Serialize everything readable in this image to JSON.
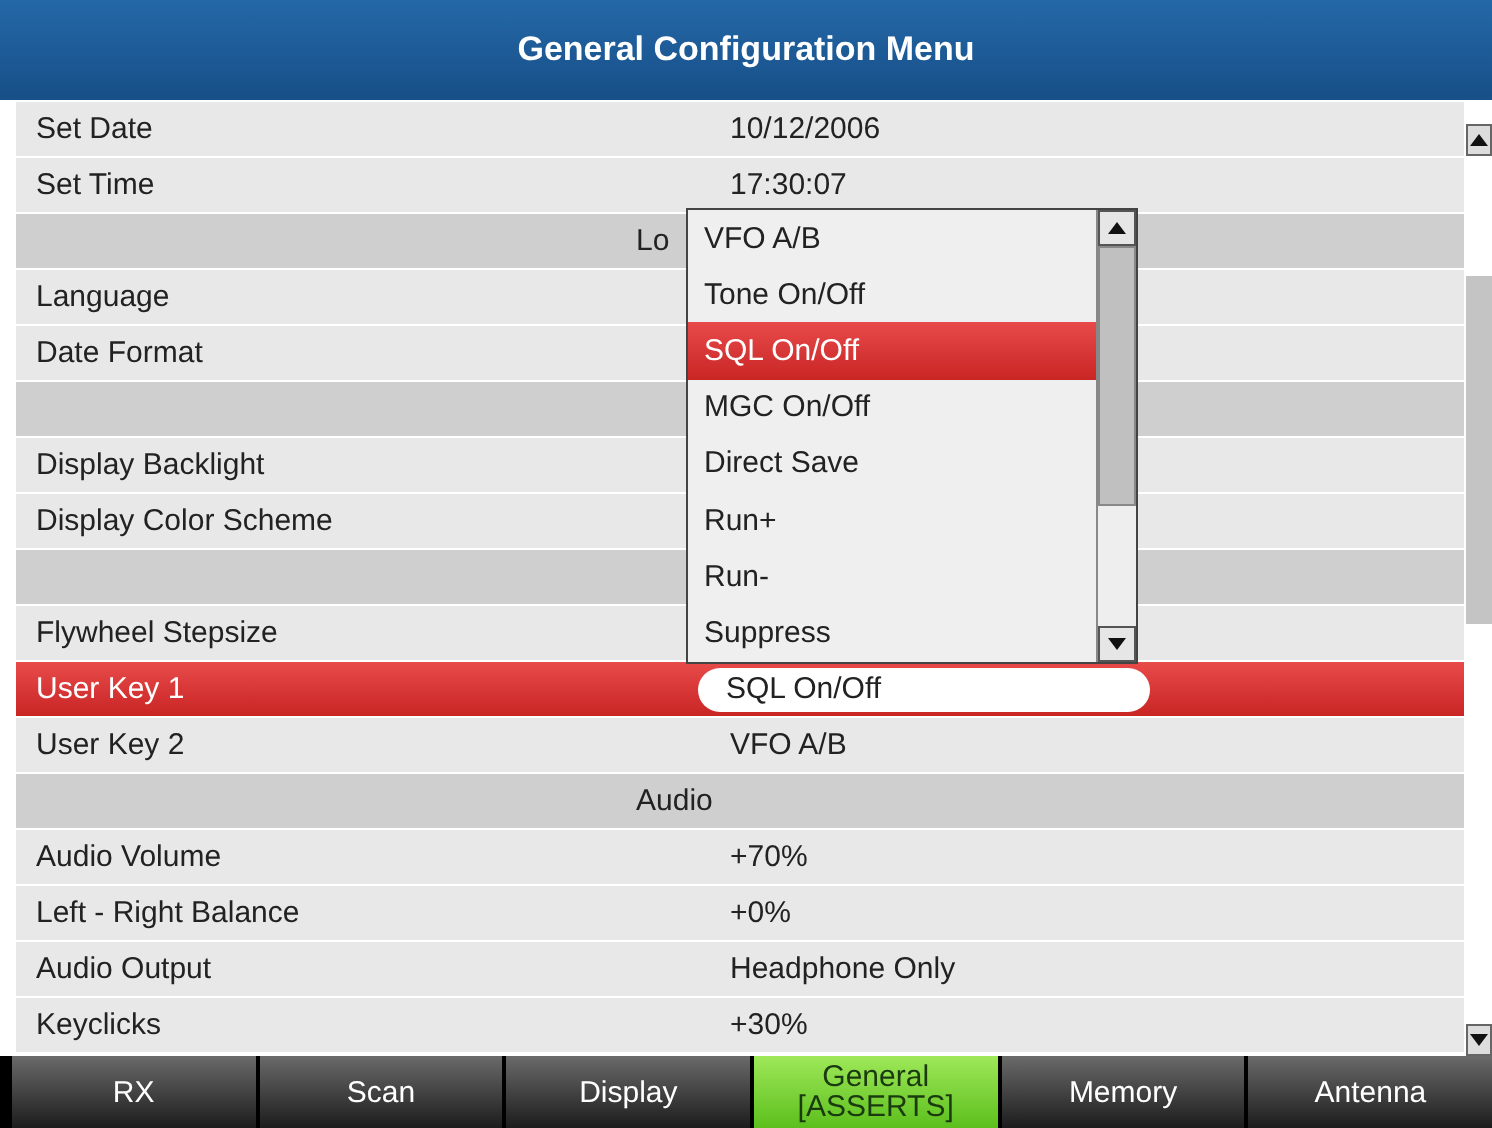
{
  "window": {
    "title": "General Configuration Menu"
  },
  "rows": [
    {
      "kind": "setting",
      "label": "Set Date",
      "value": "10/12/2006",
      "selected": false
    },
    {
      "kind": "setting",
      "label": "Set Time",
      "value": "17:30:07",
      "selected": false
    },
    {
      "kind": "section",
      "title": "Lo"
    },
    {
      "kind": "setting",
      "label": "Language",
      "selected": false
    },
    {
      "kind": "setting",
      "label": "Date Format",
      "selected": false
    },
    {
      "kind": "section"
    },
    {
      "kind": "setting",
      "label": "Display Backlight",
      "selected": false
    },
    {
      "kind": "setting",
      "label": "Display Color Scheme",
      "selected": false
    },
    {
      "kind": "section"
    },
    {
      "kind": "setting",
      "label": "Flywheel Stepsize",
      "selected": false
    },
    {
      "kind": "setting",
      "label": "User Key 1",
      "value": "SQL On/Off",
      "selected": true
    },
    {
      "kind": "setting",
      "label": "User Key 2",
      "value": "VFO A/B",
      "selected": false
    },
    {
      "kind": "section",
      "title": "Audio"
    },
    {
      "kind": "setting",
      "label": "Audio Volume",
      "value": "+70%",
      "selected": false
    },
    {
      "kind": "setting",
      "label": "Left - Right Balance",
      "value": "+0%",
      "selected": false
    },
    {
      "kind": "setting",
      "label": "Audio Output",
      "value": "Headphone Only",
      "selected": false
    },
    {
      "kind": "setting",
      "label": "Keyclicks",
      "value": "+30%",
      "selected": false
    }
  ],
  "dropdown": {
    "options": [
      {
        "label": "VFO A/B",
        "selected": false
      },
      {
        "label": "Tone On/Off",
        "selected": false
      },
      {
        "label": "SQL On/Off",
        "selected": true
      },
      {
        "label": "MGC On/Off",
        "selected": false
      },
      {
        "label": "Direct Save",
        "selected": false
      },
      {
        "label": "Run+",
        "selected": false
      },
      {
        "label": "Run-",
        "selected": false
      },
      {
        "label": "Suppress",
        "selected": false
      }
    ]
  },
  "tabs": [
    {
      "label": "RX",
      "selected": false
    },
    {
      "label": "Scan",
      "selected": false
    },
    {
      "label": "Display",
      "selected": false
    },
    {
      "label": "General [ASSERTS]",
      "selected": true
    },
    {
      "label": "Memory",
      "selected": false
    },
    {
      "label": "Antenna",
      "selected": false
    }
  ]
}
